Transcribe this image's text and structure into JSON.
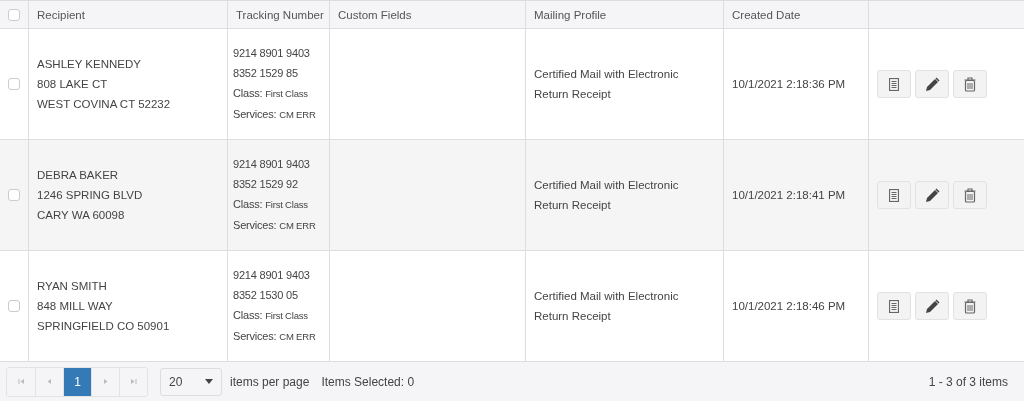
{
  "table": {
    "select_all_checked": false,
    "columns": [
      "Recipient",
      "Tracking Number",
      "Custom Fields",
      "Mailing Profile",
      "Created Date"
    ],
    "rows": [
      {
        "checked": false,
        "recipient": [
          "ASHLEY KENNEDY",
          "808 LAKE CT",
          "WEST COVINA CT 52232"
        ],
        "tracking_number": "9214 8901 9403 8352 1529 85",
        "class_label": "Class:",
        "class": "First Class",
        "services_label": "Services:",
        "services": "CM ERR",
        "mailing_profile": "Certified Mail with Electronic Return Receipt",
        "created_date": "10/1/2021 2:18:36 PM"
      },
      {
        "checked": false,
        "recipient": [
          "DEBRA BAKER",
          "1246 SPRING BLVD",
          "CARY WA 60098"
        ],
        "tracking_number": "9214 8901 9403 8352 1529 92",
        "class_label": "Class:",
        "class": "First Class",
        "services_label": "Services:",
        "services": "CM ERR",
        "mailing_profile": "Certified Mail with Electronic Return Receipt",
        "created_date": "10/1/2021 2:18:41 PM"
      },
      {
        "checked": false,
        "recipient": [
          "RYAN SMITH",
          "848 MILL WAY",
          "SPRINGFIELD CO 50901"
        ],
        "tracking_number": "9214 8901 9403 8352 1530 05",
        "class_label": "Class:",
        "class": "First Class",
        "services_label": "Services:",
        "services": "CM ERR",
        "mailing_profile": "Certified Mail with Electronic Return Receipt",
        "created_date": "10/1/2021 2:18:46 PM"
      }
    ]
  },
  "pager": {
    "pages": [
      {
        "label": "1",
        "selected": true
      }
    ],
    "page_size": "20",
    "page_size_label": "items per page",
    "items_selected": "Items Selected: 0",
    "range": "1 - 3 of 3 items"
  }
}
